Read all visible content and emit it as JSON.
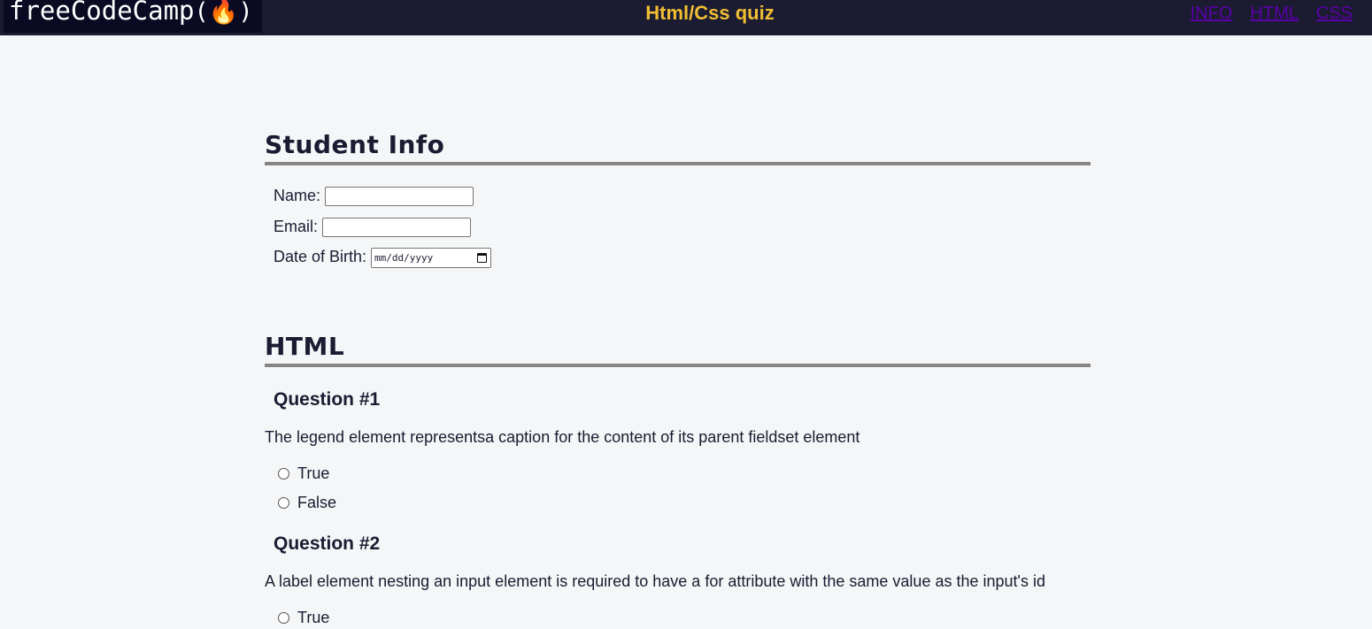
{
  "header": {
    "logo_text": "freeCodeCamp",
    "title": "Html/Css quiz",
    "nav": [
      {
        "label": "INFO"
      },
      {
        "label": "HTML"
      },
      {
        "label": "CSS"
      }
    ]
  },
  "student_info": {
    "title": "Student Info",
    "name_label": "Name:",
    "name_value": "",
    "email_label": "Email:",
    "email_value": "",
    "dob_label": "Date of Birth:",
    "dob_placeholder": "mm/dd/yyyy"
  },
  "html_section": {
    "title": "HTML",
    "questions": [
      {
        "heading": "Question #1",
        "text": "The legend element representsa caption for the content of its parent fieldset element",
        "options": [
          "True",
          "False"
        ]
      },
      {
        "heading": "Question #2",
        "text": "A label element nesting an input element is required to have a for attribute with the same value as the input's id",
        "options": [
          "True"
        ]
      }
    ]
  },
  "colors": {
    "header_bg": "#1b1b32",
    "title_color": "#f1be32",
    "nav_link": "#5a01a7",
    "page_bg": "#f5f6f7"
  }
}
